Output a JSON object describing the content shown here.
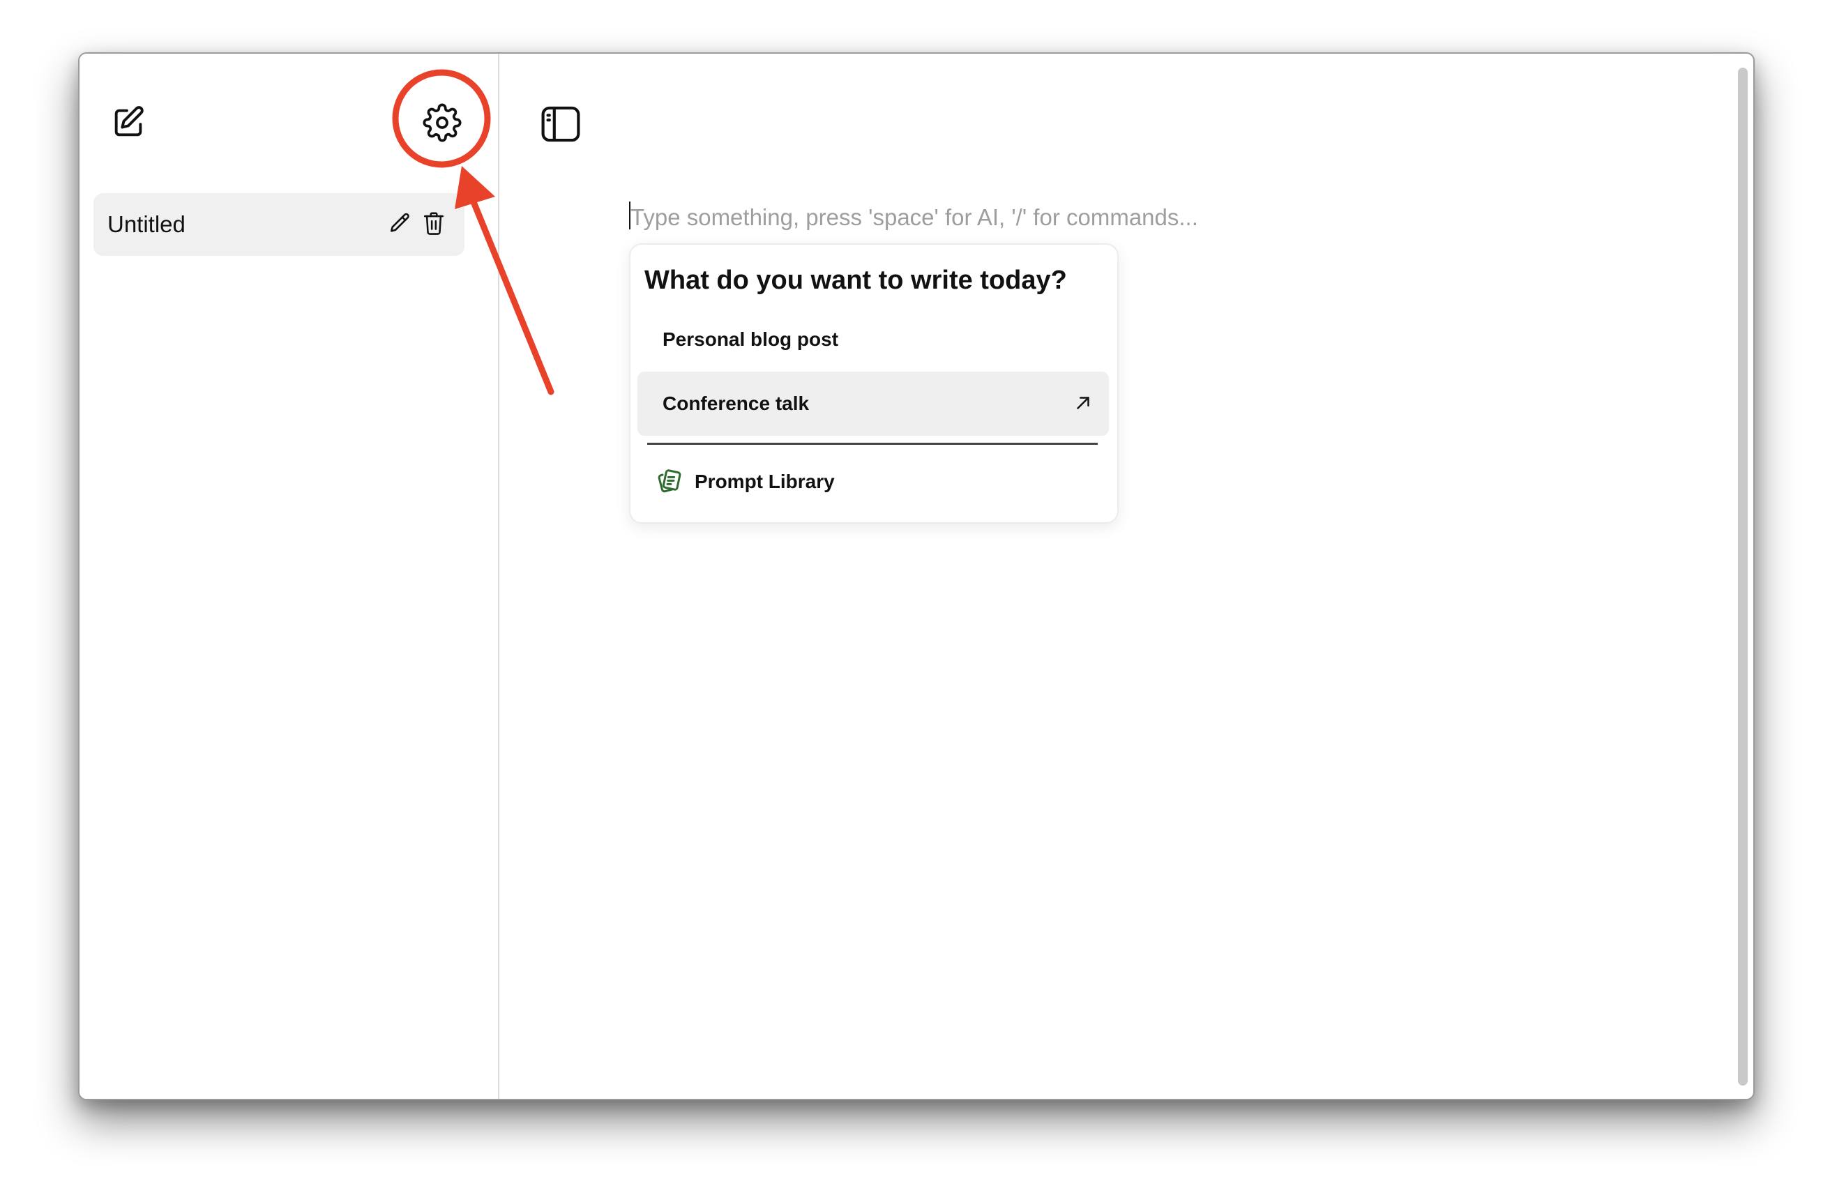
{
  "sidebar": {
    "new_note_icon": "compose-icon",
    "settings_icon": "gear-icon",
    "notes": [
      {
        "title": "Untitled",
        "edit_icon": "pencil-icon",
        "delete_icon": "trash-icon"
      }
    ]
  },
  "main": {
    "toggle_sidebar_icon": "sidebar-toggle-icon",
    "editor": {
      "placeholder": "Type something, press 'space' for AI, '/' for commands..."
    },
    "popup": {
      "heading": "What do you want to write today?",
      "items": [
        {
          "label": "Personal blog post"
        },
        {
          "label": "Conference talk",
          "icon": "arrow-up-right-icon",
          "highlighted": true
        }
      ],
      "prompt_library": {
        "label": "Prompt Library",
        "icon": "prompt-library-icon",
        "icon_color": "#2e6b2e"
      }
    }
  },
  "annotation": {
    "color": "#e8432a"
  }
}
